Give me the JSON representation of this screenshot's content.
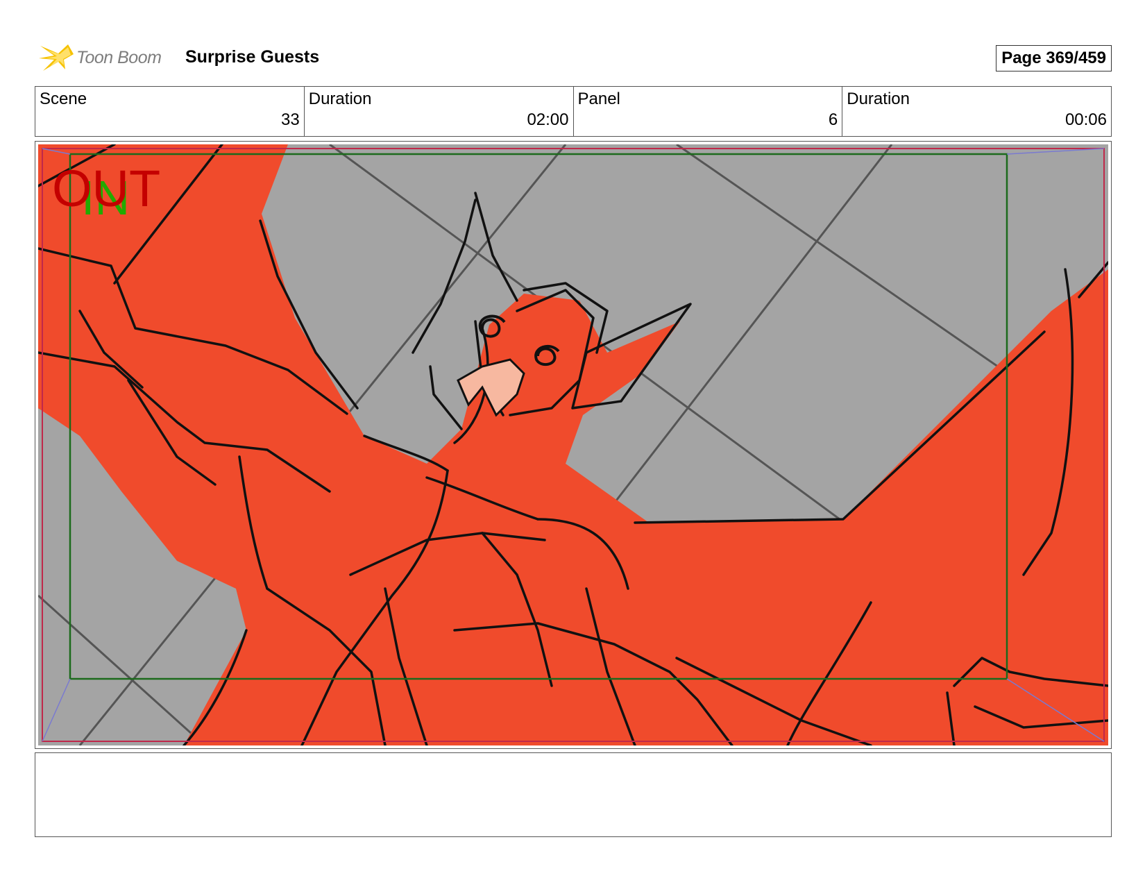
{
  "header": {
    "logo_text": "Toon Boom",
    "title": "Surprise Guests",
    "page": "Page 369/459"
  },
  "info": [
    {
      "label": "Scene",
      "value": "33"
    },
    {
      "label": "Duration",
      "value": "02:00"
    },
    {
      "label": "Panel",
      "value": "6"
    },
    {
      "label": "Duration",
      "value": "00:06"
    }
  ],
  "panel": {
    "out_marker": "OUT",
    "in_marker": "IN",
    "colors": {
      "background": "#a4a4a4",
      "character": "#f04b2c",
      "line": "#111111",
      "grid": "#555555",
      "out_marker": "#c40000",
      "in_marker": "#22aa00",
      "safe_frame": "#1c6a1c"
    }
  },
  "notes": {
    "text": ""
  }
}
